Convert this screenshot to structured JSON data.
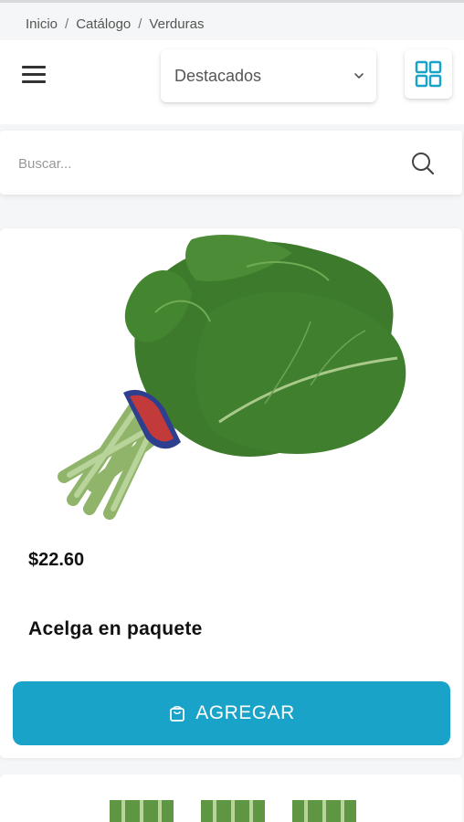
{
  "breadcrumb": {
    "items": [
      "Inicio",
      "Catálogo",
      "Verduras"
    ],
    "separator": "/"
  },
  "toolbar": {
    "menu_icon": "hamburger-icon",
    "sort": {
      "selected": "Destacados",
      "icon": "chevron-down-icon"
    },
    "view_toggle_icon": "grid-view-icon"
  },
  "search": {
    "placeholder": "Buscar...",
    "value": "",
    "icon": "search-icon"
  },
  "products": [
    {
      "image": "chard-bunch-image",
      "price": "$22.60",
      "name": "Acelga en paquete",
      "button_label": "AGREGAR",
      "button_icon": "shopping-bag-icon"
    }
  ],
  "colors": {
    "accent": "#1aa3c8",
    "grid_icon": "#1aa3c8",
    "background": "#f5f6f7",
    "card": "#ffffff",
    "text": "#111111"
  }
}
